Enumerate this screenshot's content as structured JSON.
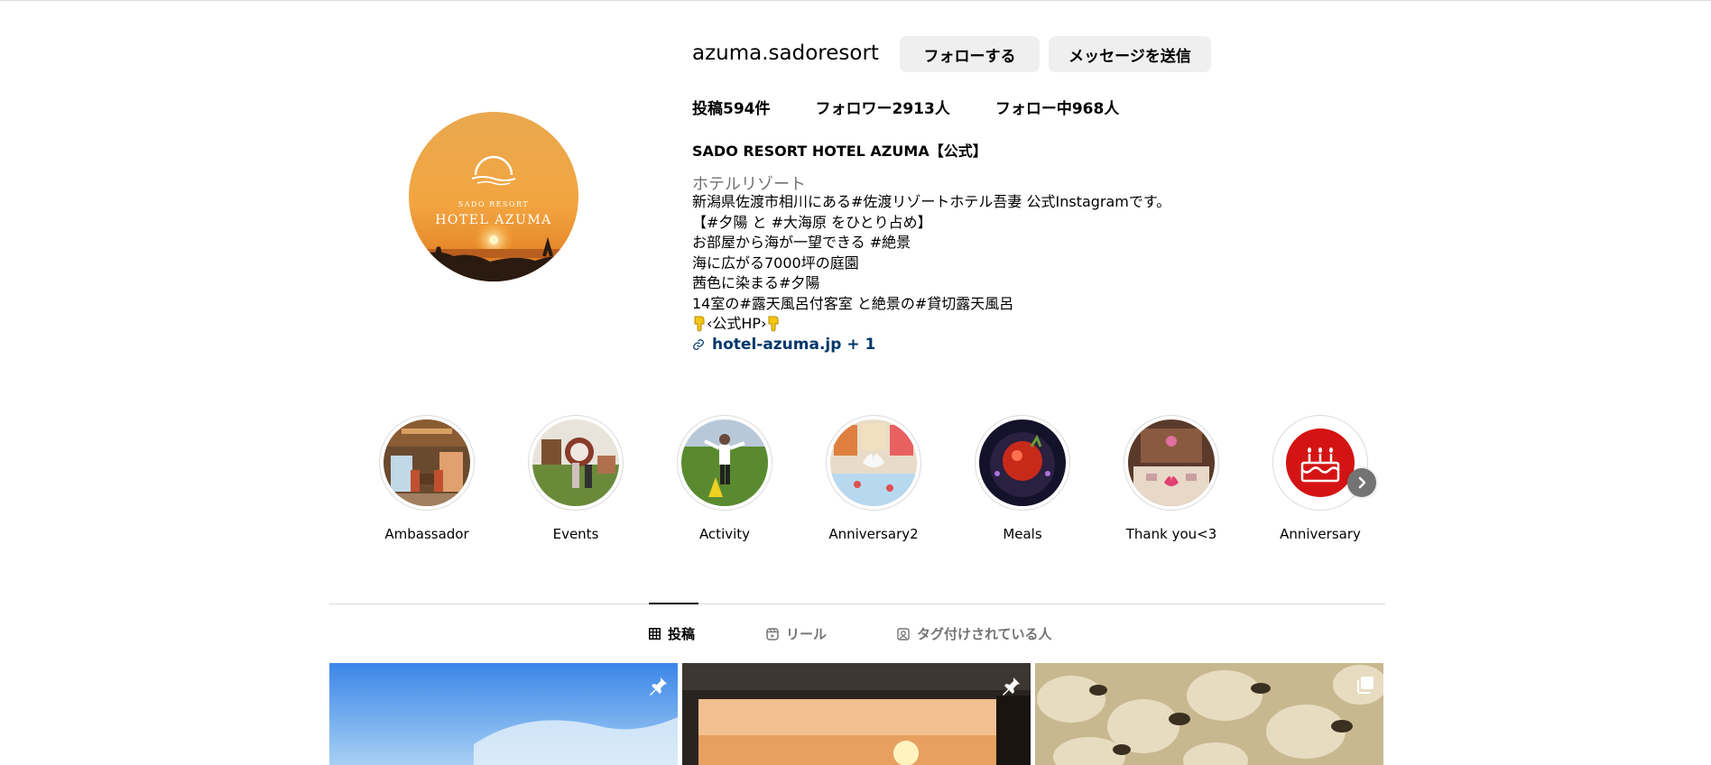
{
  "profile": {
    "username": "azuma.sadoresort",
    "follow_label": "フォローする",
    "message_label": "メッセージを送信",
    "stats": {
      "posts": "投稿594件",
      "followers": "フォロワー2913人",
      "following": "フォロー中968人"
    },
    "full_name": "SADO RESORT HOTEL AZUMA【公式】",
    "category": "ホテルリゾート",
    "bio_lines": [
      "新潟県佐渡市相川にある#佐渡リゾートホテル吾妻 公式Instagramです。",
      "【#夕陽 と #大海原 をひとり占め】",
      "お部屋から海が一望できる #絶景",
      "海に広がる7000坪の庭園",
      "茜色に染まる#夕陽",
      "14室の#露天風呂付客室 と絶景の#貸切露天風呂",
      "‹公式HP›"
    ],
    "link": "hotel-azuma.jp + 1",
    "avatar": {
      "line1": "SADO RESORT",
      "line2": "HOTEL AZUMA"
    }
  },
  "highlights": [
    {
      "label": "Ambassador",
      "icon": "highlight-ambassador"
    },
    {
      "label": "Events",
      "icon": "highlight-events"
    },
    {
      "label": "Activity",
      "icon": "highlight-activity"
    },
    {
      "label": "Anniversary2",
      "icon": "highlight-anniversary2"
    },
    {
      "label": "Meals",
      "icon": "highlight-meals"
    },
    {
      "label": "Thank you<3",
      "icon": "highlight-thank-you"
    },
    {
      "label": "Anniversary",
      "icon": "highlight-anniversary-cake"
    }
  ],
  "tabs": {
    "posts": "投稿",
    "reels": "リール",
    "tagged": "タグ付けされている人"
  },
  "colors": {
    "button_bg": "#efefef",
    "link": "#00376b",
    "secondary_text": "#737373",
    "divider": "#dbdbdb"
  }
}
